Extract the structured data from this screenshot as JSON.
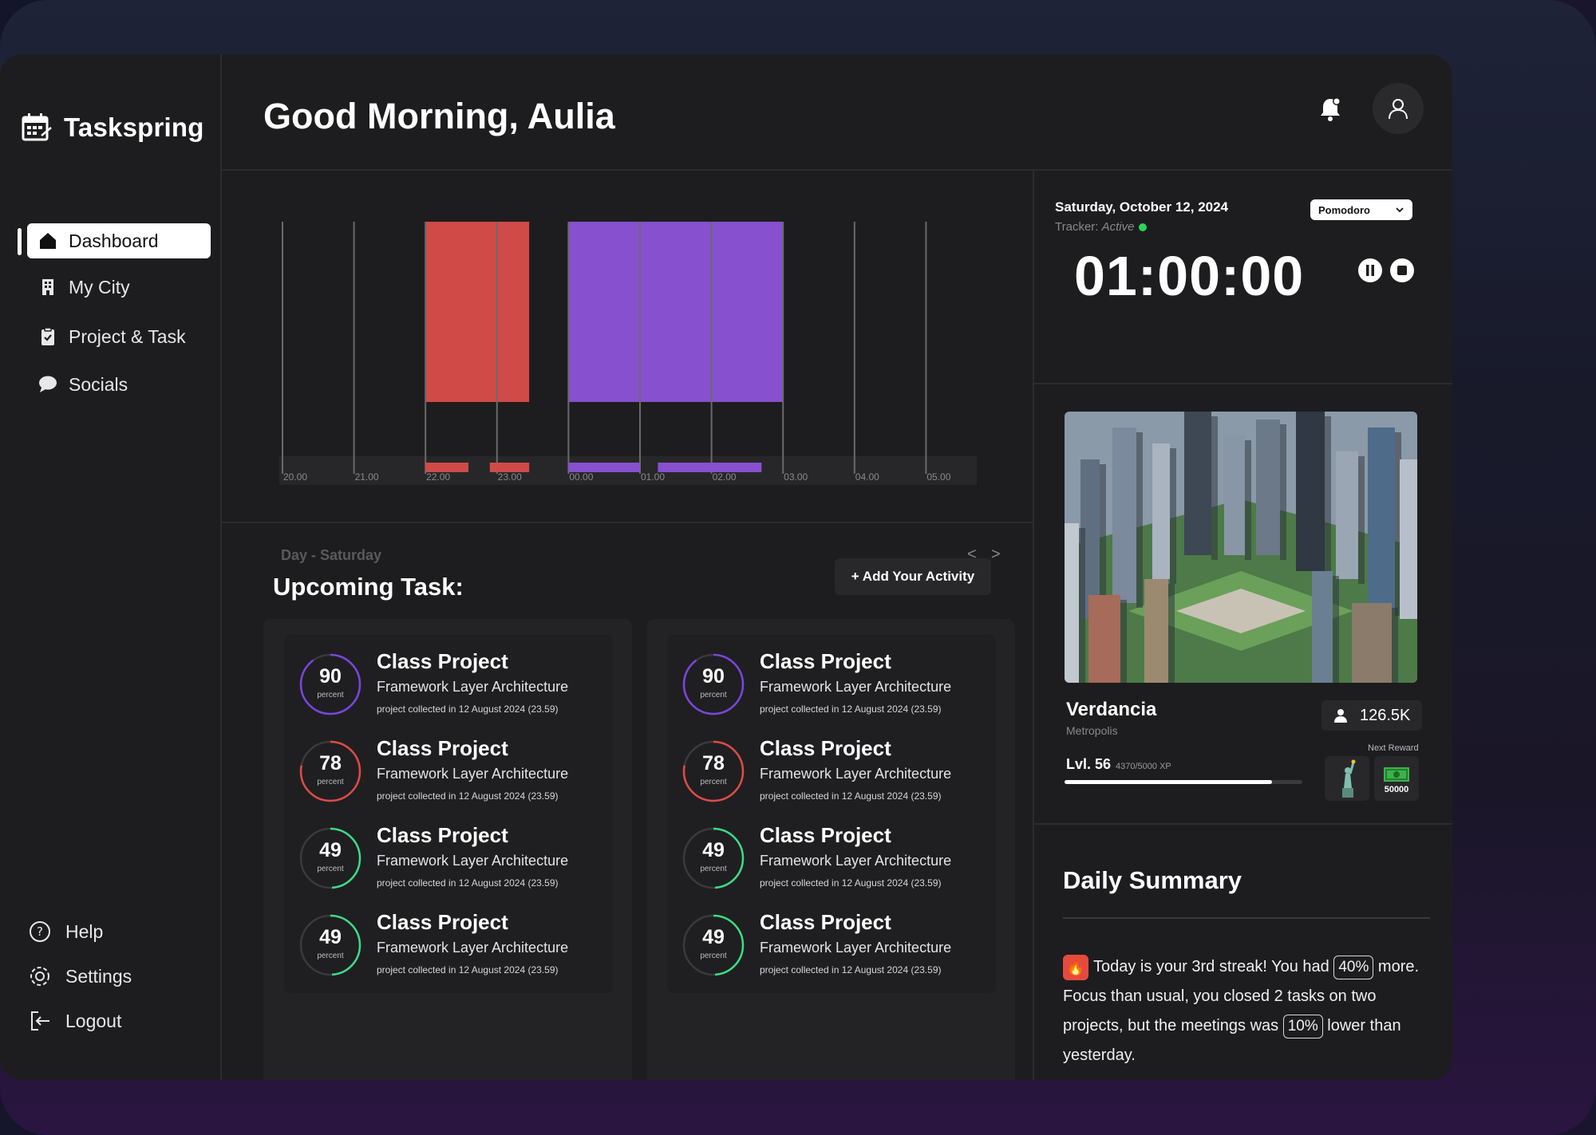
{
  "app": {
    "brand": "Taskspring"
  },
  "sidebar": {
    "items": [
      {
        "label": "Dashboard",
        "icon": "home-icon",
        "active": true
      },
      {
        "label": "My City",
        "icon": "building-icon",
        "active": false
      },
      {
        "label": "Project & Task",
        "icon": "clipboard-icon",
        "active": false
      },
      {
        "label": "Socials",
        "icon": "chat-bubble-icon",
        "active": false
      }
    ],
    "bottom": [
      {
        "label": "Help",
        "icon": "help-icon"
      },
      {
        "label": "Settings",
        "icon": "gear-icon"
      },
      {
        "label": "Logout",
        "icon": "logout-icon"
      }
    ]
  },
  "header": {
    "greeting": "Good Morning, Aulia"
  },
  "chart_data": {
    "type": "timeline",
    "title": "",
    "x_ticks": [
      "20.00",
      "21.00",
      "22.00",
      "23.00",
      "00.00",
      "01.00",
      "02.00",
      "03.00",
      "04.00",
      "05.00"
    ],
    "blocks": [
      {
        "start": "22.00",
        "end": "23.45",
        "color": "#d04b47"
      },
      {
        "start": "00.00",
        "end": "03.00",
        "color": "#8750ce"
      }
    ],
    "mini_segments": [
      {
        "start": "22.00",
        "end": "22.60",
        "color": "#d04b47"
      },
      {
        "start": "22.90",
        "end": "23.45",
        "color": "#d04b47"
      },
      {
        "start": "00.00",
        "end": "01.00",
        "color": "#8750ce"
      },
      {
        "start": "01.25",
        "end": "02.70",
        "color": "#8750ce"
      }
    ],
    "caption": "Day - Saturday",
    "nav_prev": "<",
    "nav_next": ">"
  },
  "tasks": {
    "title": "Upcoming Task:",
    "add_button": "+ Add Your Activity",
    "columns": [
      [
        {
          "percent": "90",
          "percent_label": "percent",
          "title": "Class Project",
          "subtitle": "Framework Layer Architecture",
          "meta": "project collected in 12 August 2024 (23.59)",
          "color": "#7b45e0",
          "fraction": 0.9
        },
        {
          "percent": "78",
          "percent_label": "percent",
          "title": "Class Project",
          "subtitle": "Framework Layer Architecture",
          "meta": "project collected in 12 August 2024 (23.59)",
          "color": "#e04b45",
          "fraction": 0.78
        },
        {
          "percent": "49",
          "percent_label": "percent",
          "title": "Class Project",
          "subtitle": "Framework Layer Architecture",
          "meta": "project collected in 12 August 2024 (23.59)",
          "color": "#3ddc84",
          "fraction": 0.49
        },
        {
          "percent": "49",
          "percent_label": "percent",
          "title": "Class Project",
          "subtitle": "Framework Layer Architecture",
          "meta": "project collected in 12 August 2024 (23.59)",
          "color": "#3ddc84",
          "fraction": 0.49
        }
      ],
      [
        {
          "percent": "90",
          "percent_label": "percent",
          "title": "Class Project",
          "subtitle": "Framework Layer Architecture",
          "meta": "project collected in 12 August 2024 (23.59)",
          "color": "#7b45e0",
          "fraction": 0.9
        },
        {
          "percent": "78",
          "percent_label": "percent",
          "title": "Class Project",
          "subtitle": "Framework Layer Architecture",
          "meta": "project collected in 12 August 2024 (23.59)",
          "color": "#e04b45",
          "fraction": 0.78
        },
        {
          "percent": "49",
          "percent_label": "percent",
          "title": "Class Project",
          "subtitle": "Framework Layer Architecture",
          "meta": "project collected in 12 August 2024 (23.59)",
          "color": "#3ddc84",
          "fraction": 0.49
        },
        {
          "percent": "49",
          "percent_label": "percent",
          "title": "Class Project",
          "subtitle": "Framework Layer Architecture",
          "meta": "project collected in 12 August 2024 (23.59)",
          "color": "#3ddc84",
          "fraction": 0.49
        }
      ]
    ]
  },
  "timer": {
    "date": "Saturday, October 12, 2024",
    "tracker_label": "Tracker:",
    "tracker_state": "Active",
    "mode": "Pomodoro",
    "time": "01:00:00"
  },
  "city": {
    "name": "Verdancia",
    "type": "Metropolis",
    "population": "126.5K",
    "level": "Lvl. 56",
    "xp": "4370/5000 XP",
    "xp_fraction": 0.874,
    "next_reward_label": "Next Reward",
    "reward_amount": "50000"
  },
  "summary": {
    "title": "Daily Summary",
    "part1": "Today is your 3rd streak! You had",
    "pill1": "40%",
    "part2": "more. Focus than usual, you closed 2 tasks on two projects, but the meetings was",
    "pill2": "10%",
    "part3": "lower than yesterday."
  }
}
